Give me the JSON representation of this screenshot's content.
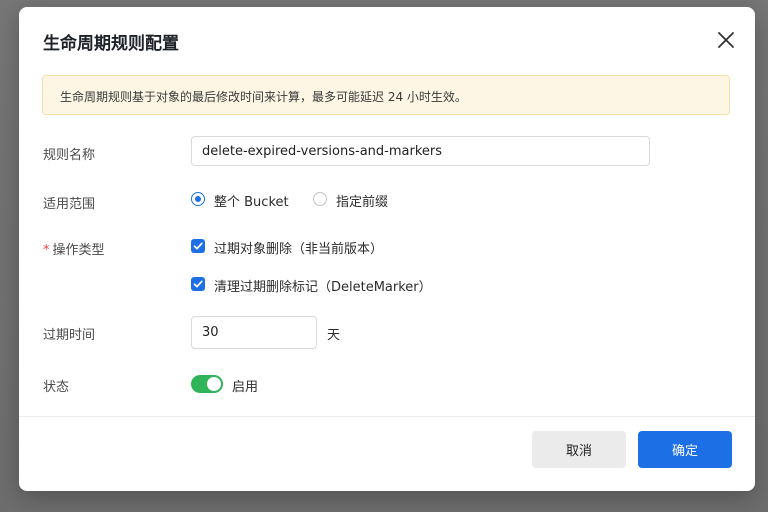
{
  "dialog": {
    "title": "生命周期规则配置",
    "notice": "生命周期规则基于对象的最后修改时间来计算，最多可能延迟 24 小时生效。"
  },
  "form": {
    "rule_name": {
      "label": "规则名称",
      "value": "delete-expired-versions-and-markers"
    },
    "scope": {
      "label": "适用范围",
      "options": [
        {
          "label": "整个 Bucket",
          "selected": true
        },
        {
          "label": "指定前缀",
          "selected": false
        }
      ]
    },
    "action_type": {
      "required_mark": "*",
      "label": "操作类型",
      "options": [
        {
          "label": "过期对象删除（非当前版本）",
          "checked": true
        },
        {
          "label": "清理过期删除标记（DeleteMarker）",
          "checked": true
        }
      ]
    },
    "expiry": {
      "label": "过期时间",
      "value": "30",
      "unit": "天"
    },
    "status": {
      "label": "状态",
      "enabled": true,
      "toggle_label": "启用"
    }
  },
  "footer": {
    "cancel_label": "取消",
    "ok_label": "确定"
  },
  "colors": {
    "primary": "#1d6fe5",
    "toggle_on": "#2fb45a",
    "notice_bg": "#fdf6e4",
    "required": "#e5484d"
  },
  "icons": {
    "close": "close-icon",
    "check": "check-icon"
  }
}
